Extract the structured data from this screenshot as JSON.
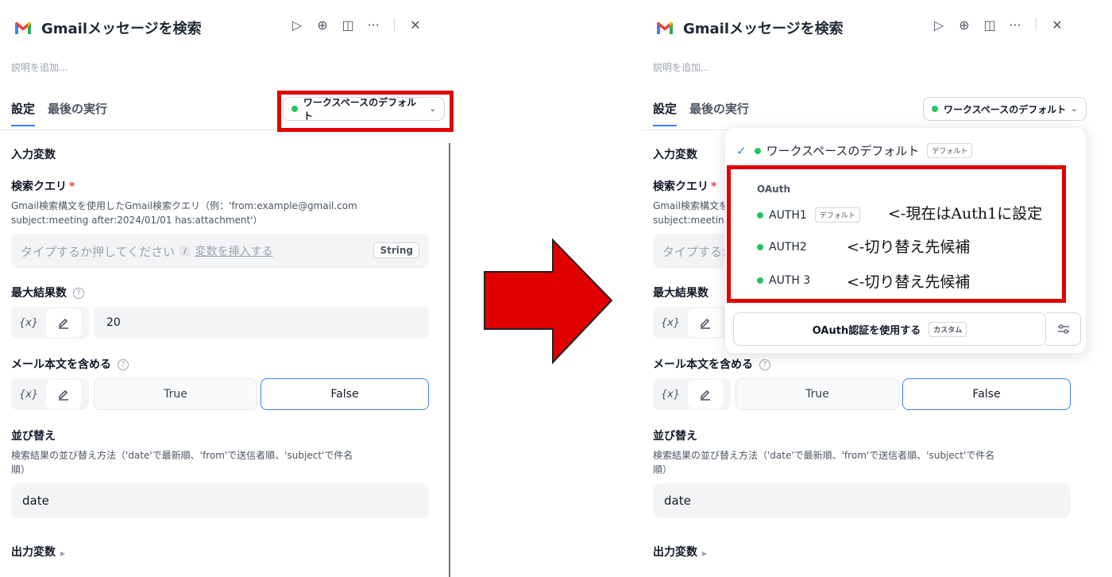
{
  "header": {
    "title": "Gmailメッセージを検索"
  },
  "description_placeholder": "説明を追加...",
  "tabs": [
    {
      "label": "設定"
    },
    {
      "label": "最後の実行"
    }
  ],
  "workspace_button": {
    "label": "ワークスペースのデフォルト"
  },
  "input_section": {
    "title": "入力変数"
  },
  "search_query": {
    "label": "検索クエリ",
    "required_mark": "*",
    "help_line1": "Gmail検索構文を使用したGmail検索クエリ（例：'from:example@gmail.com",
    "help_line2": "subject:meeting after:2024/01/01 has:attachment'）",
    "placeholder": "タイプするか押してください",
    "kbd": "/",
    "insert_var": "変数を挿入する",
    "type_badge": "String"
  },
  "max_results": {
    "label": "最大結果数",
    "help_mark": "?",
    "var_label": "{x}",
    "value": "20"
  },
  "include_body": {
    "label": "メール本文を含める",
    "help_mark": "?",
    "var_label": "{x}",
    "true_label": "True",
    "false_label": "False",
    "selected": "False"
  },
  "sort": {
    "label": "並び替え",
    "help_line1": "検索結果の並び替え方法（'date'で最新順、'from'で送信者順、'subject'で件名",
    "help_line2": "順）",
    "value": "date"
  },
  "output_section": {
    "title": "出力変数"
  },
  "dropdown": {
    "workspace_item": "ワークスペースのデフォルト",
    "workspace_badge": "デフォルト",
    "oauth_header": "OAuth",
    "auth_items": [
      {
        "label": "AUTH1",
        "badge": "デフォルト",
        "note": "<-現在はAuth1に設定"
      },
      {
        "label": "AUTH2",
        "note": "<-切り替え先候補"
      },
      {
        "label": "AUTH 3",
        "note": "<-切り替え先候補"
      }
    ],
    "oauth_button": "OAuth認証を使用する",
    "oauth_button_badge": "カスタム"
  },
  "colors": {
    "accent": "#3b82f6",
    "highlight": "#e00000",
    "status_green": "#22c55e",
    "arrow": "#e00000"
  }
}
